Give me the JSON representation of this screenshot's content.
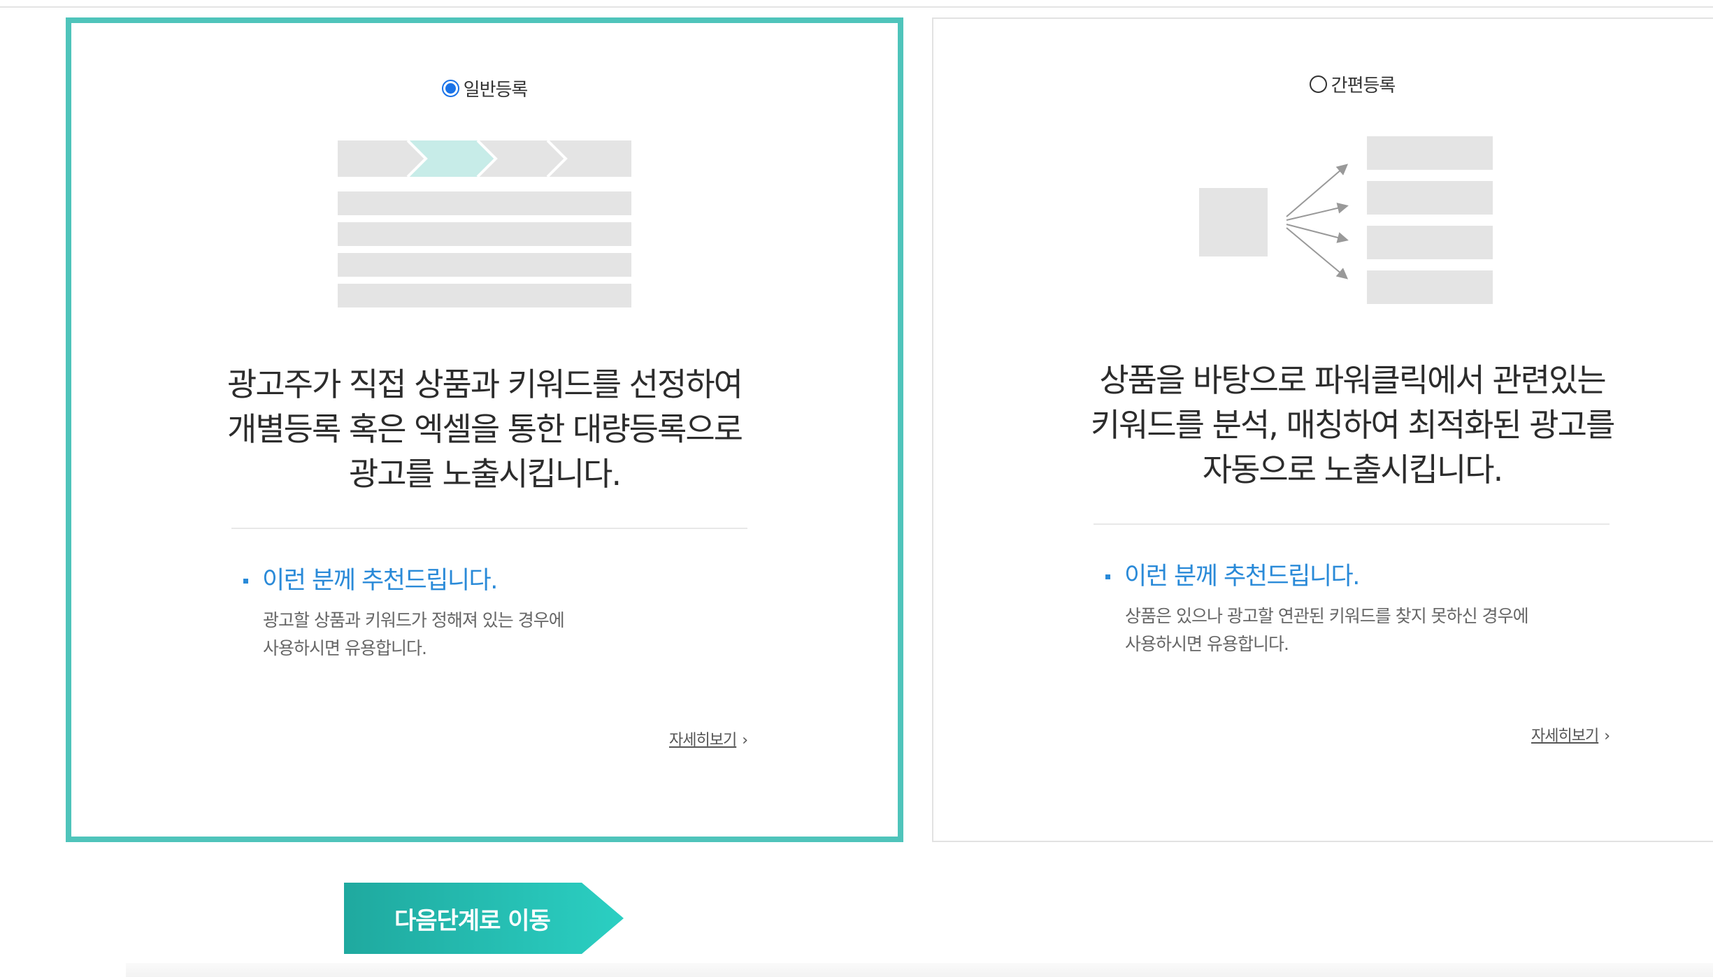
{
  "options": [
    {
      "radio_label": "일반등록",
      "selected": true,
      "description": [
        "광고주가 직접 상품과 키워드를 선정하여",
        "개별등록 혹은 엑셀을 통한 대량등록으로",
        "광고를 노출시킵니다."
      ],
      "recommend_title": "이런 분께 추천드립니다.",
      "recommend_desc": [
        "광고할 상품과 키워드가 정해져 있는 경우에",
        "사용하시면 유용합니다."
      ],
      "more_link": "자세히보기"
    },
    {
      "radio_label": "간편등록",
      "selected": false,
      "description": [
        "상품을 바탕으로 파워클릭에서 관련있는",
        "키워드를 분석, 매칭하여 최적화된 광고를",
        "자동으로 노출시킵니다."
      ],
      "recommend_title": "이런 분께 추천드립니다.",
      "recommend_desc": [
        "상품은 있으나 광고할 연관된 키워드를 찾지 못하신 경우에",
        "사용하시면 유용합니다."
      ],
      "more_link": "자세히보기"
    }
  ],
  "next_button": "다음단계로 이동",
  "colors": {
    "selected_border": "#4fc4bb",
    "accent_blue": "#2a8ad8",
    "button_teal": "#2bcfc2",
    "illustration_grey": "#e4e4e4",
    "illustration_highlight": "#c7ece8"
  },
  "icons": {
    "more_chevron": "chevron-right-icon"
  }
}
